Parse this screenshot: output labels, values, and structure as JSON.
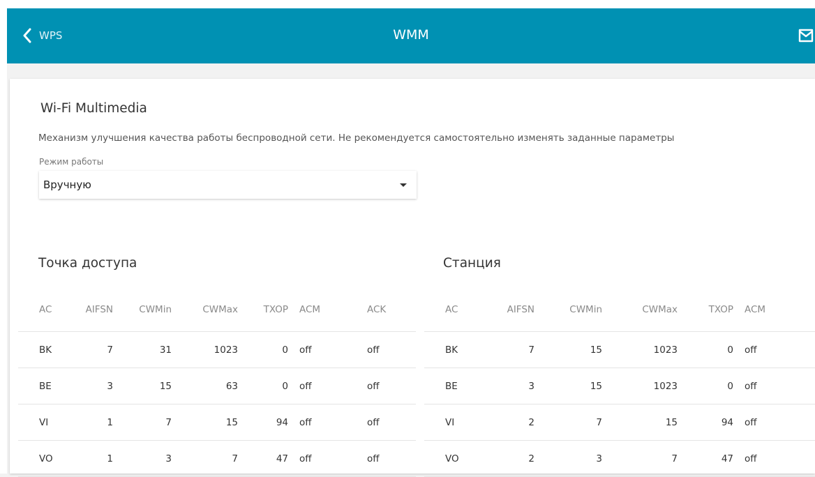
{
  "header": {
    "back_label": "WPS",
    "title": "WMM",
    "back_icon": "chevron-left-icon",
    "mail_icon": "mail-icon"
  },
  "section": {
    "title": "Wi-Fi Multimedia",
    "description": "Механизм улучшения качества работы беспроводной сети. Не рекомендуется самостоятельно изменять заданные параметры",
    "mode_label": "Режим работы",
    "mode_value": "Вручную"
  },
  "ap_table": {
    "title": "Точка доступа",
    "headers": [
      "AC",
      "AIFSN",
      "CWMin",
      "CWMax",
      "TXOP",
      "ACM",
      "ACK"
    ],
    "rows": [
      [
        "BK",
        "7",
        "31",
        "1023",
        "0",
        "off",
        "off"
      ],
      [
        "BE",
        "3",
        "15",
        "63",
        "0",
        "off",
        "off"
      ],
      [
        "VI",
        "1",
        "7",
        "15",
        "94",
        "off",
        "off"
      ],
      [
        "VO",
        "1",
        "3",
        "7",
        "47",
        "off",
        "off"
      ]
    ]
  },
  "station_table": {
    "title": "Станция",
    "headers": [
      "AC",
      "AIFSN",
      "CWMin",
      "CWMax",
      "TXOP",
      "ACM"
    ],
    "rows": [
      [
        "BK",
        "7",
        "15",
        "1023",
        "0",
        "off"
      ],
      [
        "BE",
        "3",
        "15",
        "1023",
        "0",
        "off"
      ],
      [
        "VI",
        "2",
        "7",
        "15",
        "94",
        "off"
      ],
      [
        "VO",
        "2",
        "3",
        "7",
        "47",
        "off"
      ]
    ]
  },
  "colors": {
    "header_bg": "#0091b3",
    "page_bg": "#f2f2f2",
    "card_bg": "#ffffff"
  }
}
